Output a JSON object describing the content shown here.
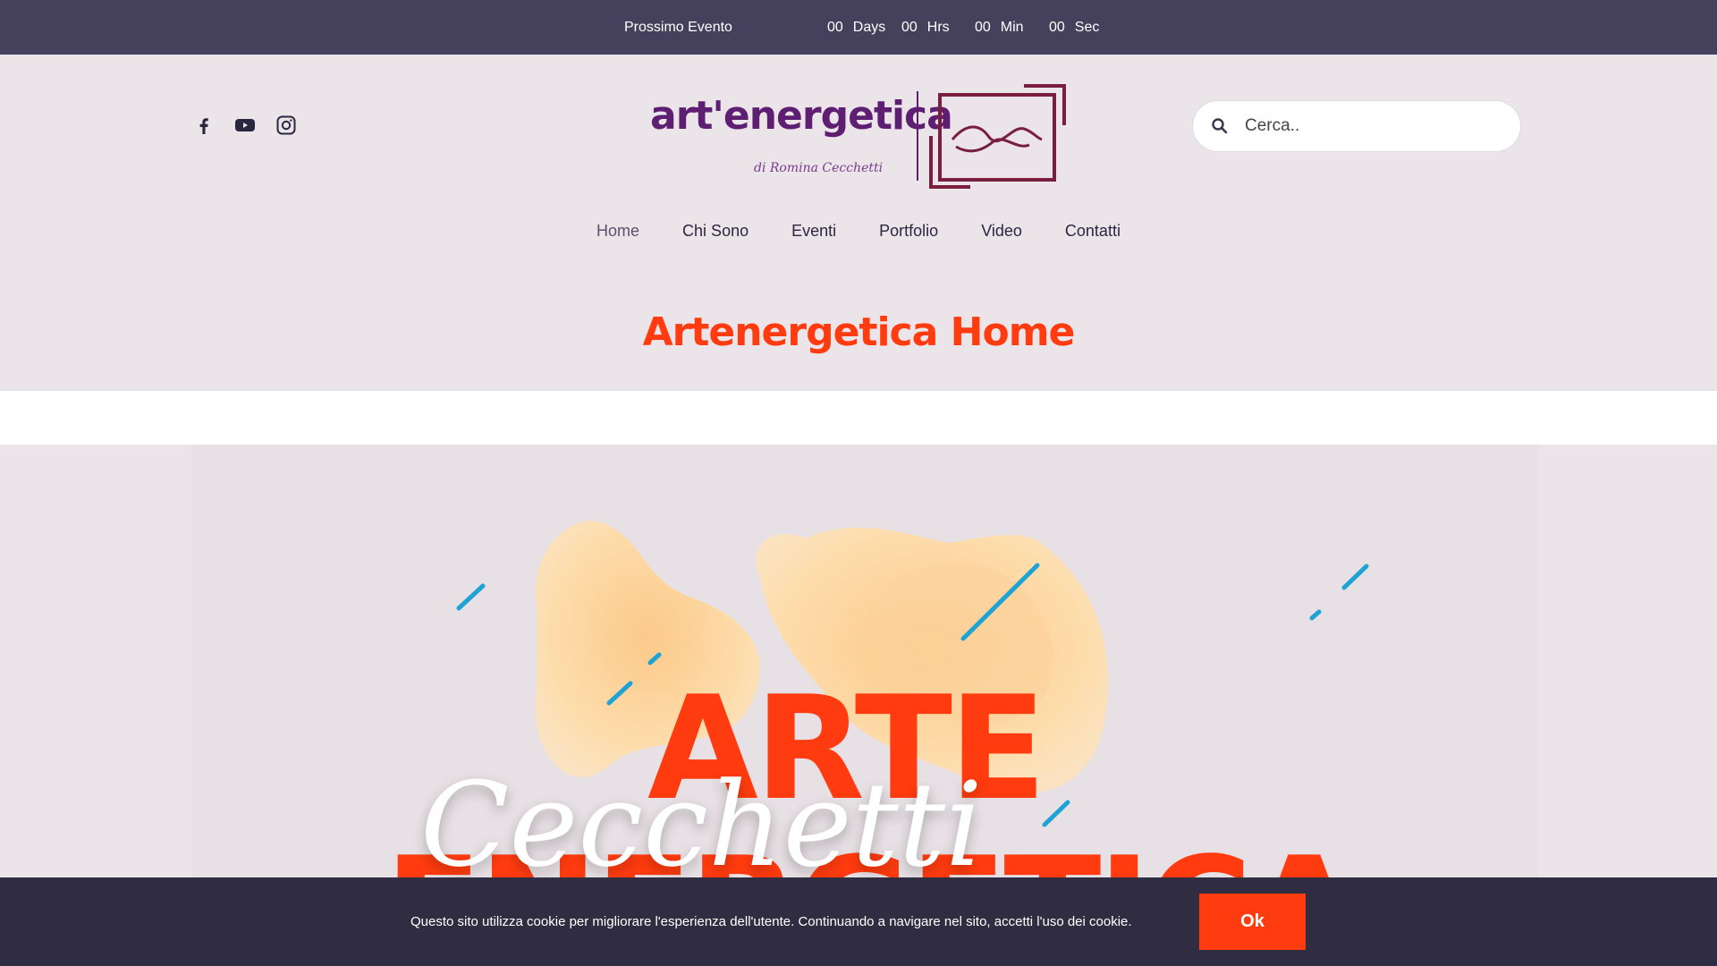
{
  "topbar": {
    "label": "Prossimo Evento",
    "countdown": [
      {
        "value": "00",
        "unit": "Days"
      },
      {
        "value": "00",
        "unit": "Hrs"
      },
      {
        "value": "00",
        "unit": "Min"
      },
      {
        "value": "00",
        "unit": "Sec"
      }
    ]
  },
  "social": [
    {
      "icon": "facebook-icon"
    },
    {
      "icon": "youtube-icon"
    },
    {
      "icon": "instagram-icon"
    }
  ],
  "logo": {
    "word": "art'energetica",
    "subtitle": "di Romina Cecchetti"
  },
  "search": {
    "placeholder": "Cerca.."
  },
  "nav": [
    {
      "label": "Home",
      "active": true
    },
    {
      "label": "Chi Sono",
      "active": false
    },
    {
      "label": "Eventi",
      "active": false
    },
    {
      "label": "Portfolio",
      "active": false
    },
    {
      "label": "Video",
      "active": false
    },
    {
      "label": "Contatti",
      "active": false
    }
  ],
  "page_title": "Artenergetica Home",
  "hero": {
    "line1": "ARTE",
    "line2": "ENERGETICA",
    "script": "Cecchetti"
  },
  "cookie": {
    "message": "Questo sito utilizza cookie per migliorare l'esperienza dell'utente. Continuando a navigare nel sito, accetti l'uso dei cookie.",
    "ok_label": "Ok"
  },
  "colors": {
    "topbar": "#45415d",
    "header_bg": "#ebe4e8",
    "accent": "#ff3b0f",
    "logo": "#5e1f73",
    "cookie_bg": "#302c42",
    "blob": "#fcd9a3",
    "stroke": "#1ea3d4"
  }
}
